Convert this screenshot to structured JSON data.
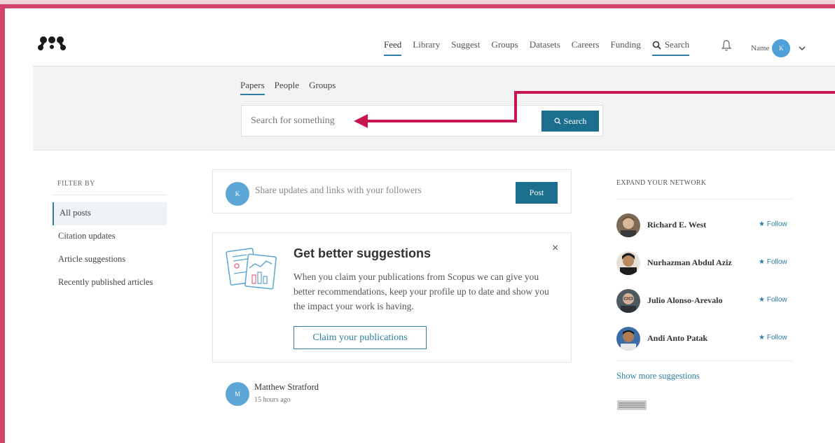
{
  "nav": {
    "items": [
      "Feed",
      "Library",
      "Suggest",
      "Groups",
      "Datasets",
      "Careers",
      "Funding"
    ],
    "active": "Feed",
    "search_label": "Search",
    "user_name": "Name",
    "user_initial": "K"
  },
  "search": {
    "tabs": [
      "Papers",
      "People",
      "Groups"
    ],
    "active_tab": "Papers",
    "placeholder": "Search for something",
    "button_label": "Search"
  },
  "filter": {
    "title": "FILTER BY",
    "items": [
      "All posts",
      "Citation updates",
      "Article suggestions",
      "Recently published articles"
    ],
    "active": "All posts"
  },
  "share": {
    "avatar_initial": "K",
    "prompt": "Share updates and links with your followers",
    "post_label": "Post"
  },
  "suggestion_card": {
    "title": "Get better suggestions",
    "body": "When you claim your publications from Scopus we can give you better recommendations, keep your profile up to date and show you the impact your work is having.",
    "button_label": "Claim your publications",
    "close_symbol": "×"
  },
  "feed": {
    "author": "Matthew Stratford",
    "author_initial": "M",
    "time": "15 hours ago"
  },
  "network": {
    "title": "EXPAND YOUR NETWORK",
    "follow_label": "Follow",
    "people": [
      {
        "name": "Richard E. West"
      },
      {
        "name": "Nurhazman Abdul Aziz"
      },
      {
        "name": "Julio Alonso-Arevalo"
      },
      {
        "name": "Andi Anto Patak"
      }
    ],
    "show_more": "Show more suggestions"
  },
  "colors": {
    "accent": "#1c6e8f",
    "link": "#2d7ea6",
    "frame": "#d2456a",
    "annotation_arrow": "#c8174e"
  }
}
